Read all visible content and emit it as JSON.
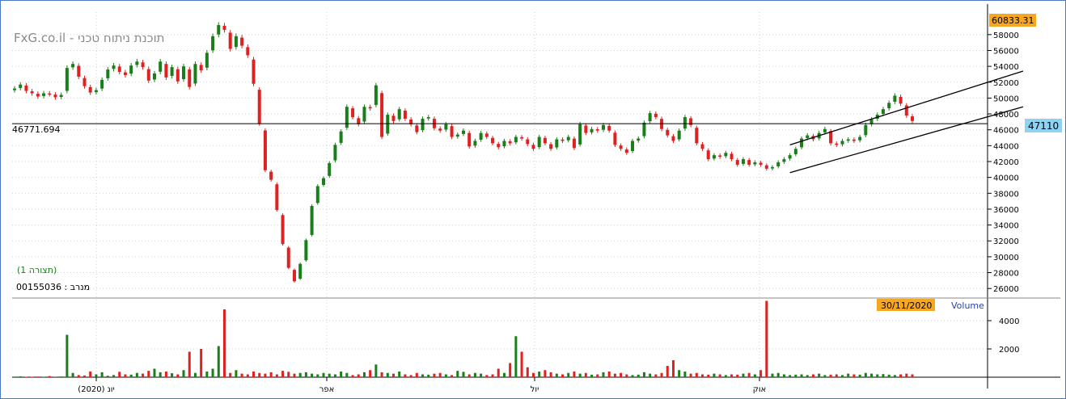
{
  "watermark": "FxG.co.il - תוכנת ניתוח טכני",
  "top_value": "60833.31",
  "last_price": "47110",
  "hline_label": "46771.694",
  "view_label": "(תצורה 1)",
  "symbol_label": "מנרב : 00155036",
  "date_label": "30/11/2020",
  "volume_label": "Volume",
  "colors": {
    "up": "#1a7f1a",
    "down": "#dd2222",
    "accent": "#f5a623",
    "price_box": "#8fd3f4",
    "grid": "#d0d0d0"
  },
  "chart_data": [
    {
      "type": "candlestick",
      "title": "",
      "ylim": [
        25000,
        60833.31
      ],
      "yticks": [
        "58000",
        "56000",
        "54000",
        "52000",
        "50000",
        "48000",
        "46000",
        "44000",
        "42000",
        "40000",
        "38000",
        "36000",
        "34000",
        "32000",
        "30000",
        "28000",
        "26000"
      ],
      "xticks": [
        "יונ (2020)",
        "אפר",
        "יול",
        "אוק"
      ],
      "horizontal_line": 46771.694,
      "closes": [
        51200,
        51700,
        50900,
        50600,
        50200,
        50600,
        50500,
        50100,
        50400,
        53800,
        54300,
        52700,
        51500,
        50700,
        51000,
        52300,
        53600,
        54100,
        53300,
        52900,
        54100,
        54600,
        53900,
        52200,
        53100,
        54600,
        52600,
        53900,
        52100,
        54000,
        51400,
        54300,
        53500,
        55700,
        57800,
        59200,
        58600,
        56200,
        57800,
        56600,
        55400,
        51800,
        46800,
        40900,
        39700,
        35900,
        31600,
        28600,
        26900,
        29100,
        32100,
        36400,
        38900,
        39900,
        41800,
        44100,
        45800,
        48900,
        47600,
        46700,
        48900,
        48700,
        51600,
        45100,
        47900,
        47100,
        48600,
        47400,
        46700,
        45700,
        47400,
        47600,
        46200,
        45900,
        46700,
        45100,
        45400,
        45900,
        43900,
        44600,
        45600,
        45100,
        44300,
        43800,
        44600,
        44300,
        45100,
        44900,
        44200,
        43600,
        45100,
        44300,
        43600,
        44800,
        44600,
        45100,
        43700,
        46700,
        45600,
        46100,
        45900,
        46600,
        45900,
        44100,
        43600,
        43100,
        44600,
        44900,
        46900,
        48100,
        47600,
        46100,
        45300,
        44600,
        45900,
        47600,
        46600,
        44300,
        43600,
        42300,
        42800,
        42600,
        43100,
        42300,
        41600,
        42300,
        41600,
        41900,
        41600,
        41100,
        41300,
        41900,
        42300,
        42800,
        43600,
        44900,
        45300,
        44800,
        45600,
        46100,
        44300,
        44100,
        44600,
        44800,
        44600,
        45100,
        46600,
        47300,
        47900,
        48600,
        49400,
        50300,
        49300,
        47800,
        47110
      ],
      "volumes": [
        40,
        60,
        30,
        25,
        45,
        30,
        80,
        20,
        50,
        3000,
        300,
        150,
        120,
        400,
        200,
        350,
        100,
        150,
        380,
        200,
        180,
        300,
        250,
        450,
        600,
        350,
        400,
        280,
        200,
        500,
        1800,
        300,
        2000,
        400,
        600,
        2200,
        4800,
        300,
        500,
        250,
        200,
        400,
        300,
        250,
        350,
        200,
        450,
        380,
        250,
        300,
        350,
        250,
        200,
        300,
        250,
        200,
        400,
        300,
        150,
        200,
        350,
        500,
        900,
        350,
        300,
        250,
        400,
        200,
        150,
        300,
        200,
        180,
        250,
        300,
        200,
        150,
        450,
        380,
        200,
        300,
        250,
        150,
        200,
        600,
        300,
        1000,
        2900,
        1800,
        700,
        300,
        400,
        500,
        350,
        250,
        200,
        300,
        400,
        250,
        300,
        180,
        200,
        350,
        400,
        250,
        300,
        200,
        150,
        180,
        350,
        250,
        200,
        300,
        800,
        1200,
        500,
        400,
        250,
        300,
        200,
        180,
        250,
        200,
        150,
        200,
        180,
        250,
        300,
        200,
        500,
        5400,
        250,
        300,
        200,
        150,
        180,
        200,
        150,
        200,
        250,
        150,
        180,
        200,
        150,
        250,
        200,
        180,
        300,
        250,
        200,
        220,
        180,
        150,
        200,
        250,
        200
      ],
      "vol_yticks": [
        "4000",
        "2000"
      ],
      "vol_ylim": [
        0,
        5600
      ],
      "channel": [
        {
          "from": [
            133,
            44100
          ],
          "to": [
            173,
            53400
          ]
        },
        {
          "from": [
            133,
            40600
          ],
          "to": [
            173,
            48900
          ]
        }
      ]
    }
  ]
}
